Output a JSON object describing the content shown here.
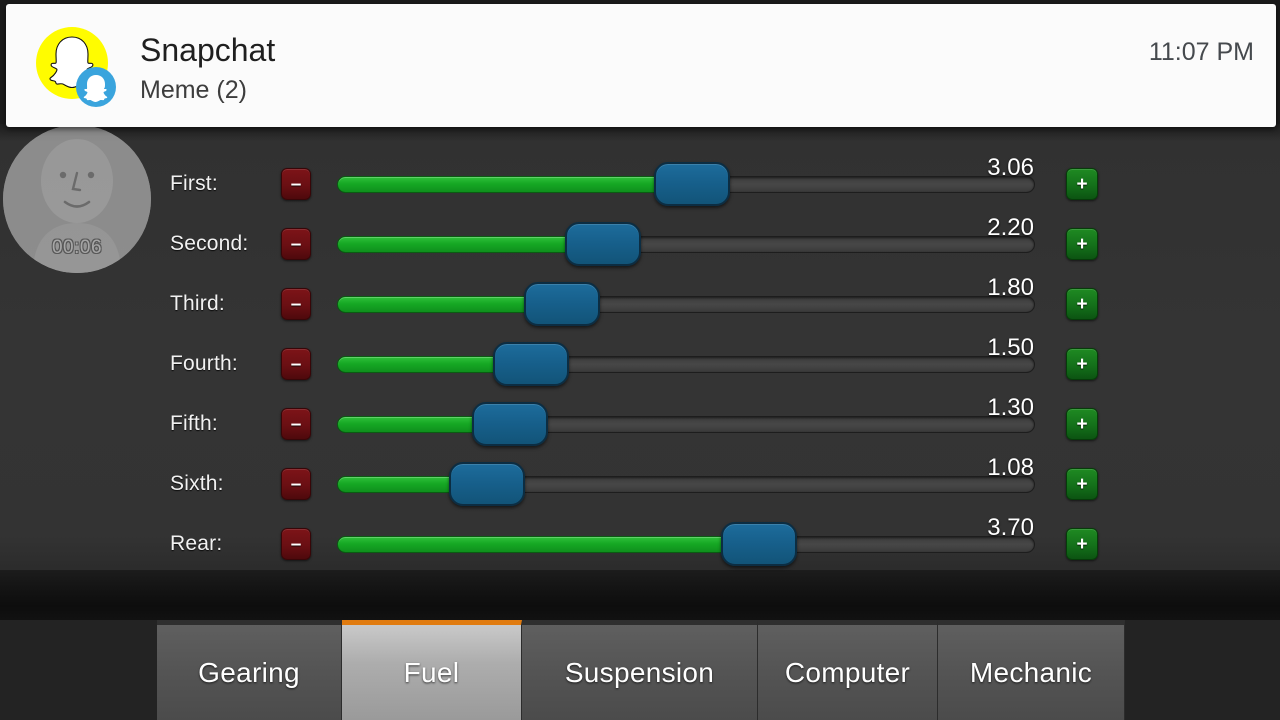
{
  "notification": {
    "app_name": "Snapchat",
    "message": "Meme (2)",
    "time": "11:07 PM",
    "logo_icon": "snapchat-ghost-icon",
    "badge_icon": "snapchat-friend-badge-icon",
    "brand_yellow": "#FFFC00",
    "badge_blue": "#3aa4dd"
  },
  "avatar_bubble": {
    "timer": "00:06",
    "icon": "person-avatar-icon"
  },
  "tuning_panel": {
    "minus_label": "–",
    "plus_label": "+",
    "slider_min": 0.0,
    "slider_max": 6.0,
    "rows": [
      {
        "label": "First:",
        "value": "3.06",
        "value_num": 3.06
      },
      {
        "label": "Second:",
        "value": "2.20",
        "value_num": 2.2
      },
      {
        "label": "Third:",
        "value": "1.80",
        "value_num": 1.8
      },
      {
        "label": "Fourth:",
        "value": "1.50",
        "value_num": 1.5
      },
      {
        "label": "Fifth:",
        "value": "1.30",
        "value_num": 1.3
      },
      {
        "label": "Sixth:",
        "value": "1.08",
        "value_num": 1.08
      },
      {
        "label": "Rear:",
        "value": "3.70",
        "value_num": 3.7
      }
    ]
  },
  "tabbar": {
    "active_index": 1,
    "active_indicator_color": "#e07b10",
    "tabs": [
      {
        "label": "Gearing"
      },
      {
        "label": "Fuel"
      },
      {
        "label": "Suspension"
      },
      {
        "label": "Computer"
      },
      {
        "label": "Mechanic"
      }
    ]
  }
}
